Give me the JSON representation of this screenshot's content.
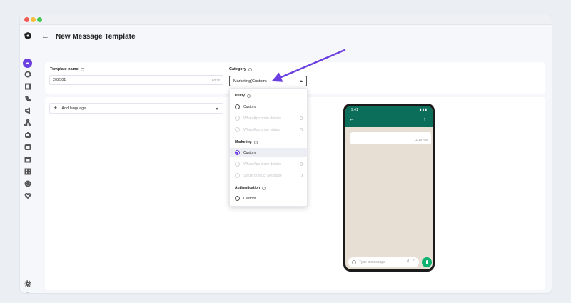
{
  "header": {
    "title": "New Message Template"
  },
  "template_name": {
    "label": "Template name",
    "value": "202501",
    "counter": "6/512"
  },
  "category": {
    "label": "Category",
    "value": "Marketing(Custom)"
  },
  "add_language": {
    "label": "Add language"
  },
  "dropdown": {
    "groups": [
      {
        "label": "Utility",
        "options": [
          {
            "label": "Custom",
            "disabled": false,
            "selected": false
          },
          {
            "label": "WhatsApp order details",
            "disabled": true,
            "selected": false
          },
          {
            "label": "WhatsApp order status",
            "disabled": true,
            "selected": false
          }
        ]
      },
      {
        "label": "Marketing",
        "options": [
          {
            "label": "Custom",
            "disabled": false,
            "selected": true
          },
          {
            "label": "WhatsApp order details",
            "disabled": true,
            "selected": false
          },
          {
            "label": "Single product Message",
            "disabled": true,
            "selected": false
          }
        ]
      },
      {
        "label": "Authentication",
        "options": [
          {
            "label": "Custom",
            "disabled": false,
            "selected": false
          }
        ]
      }
    ]
  },
  "phone": {
    "time": "9:41",
    "message_time": "11:14 AM",
    "input_placeholder": "Type a message"
  },
  "colors": {
    "accent": "#6b3fe0",
    "whatsapp_header": "#0b6e5b",
    "whatsapp_mic": "#0db26e",
    "arrow": "#6b3fe0"
  }
}
